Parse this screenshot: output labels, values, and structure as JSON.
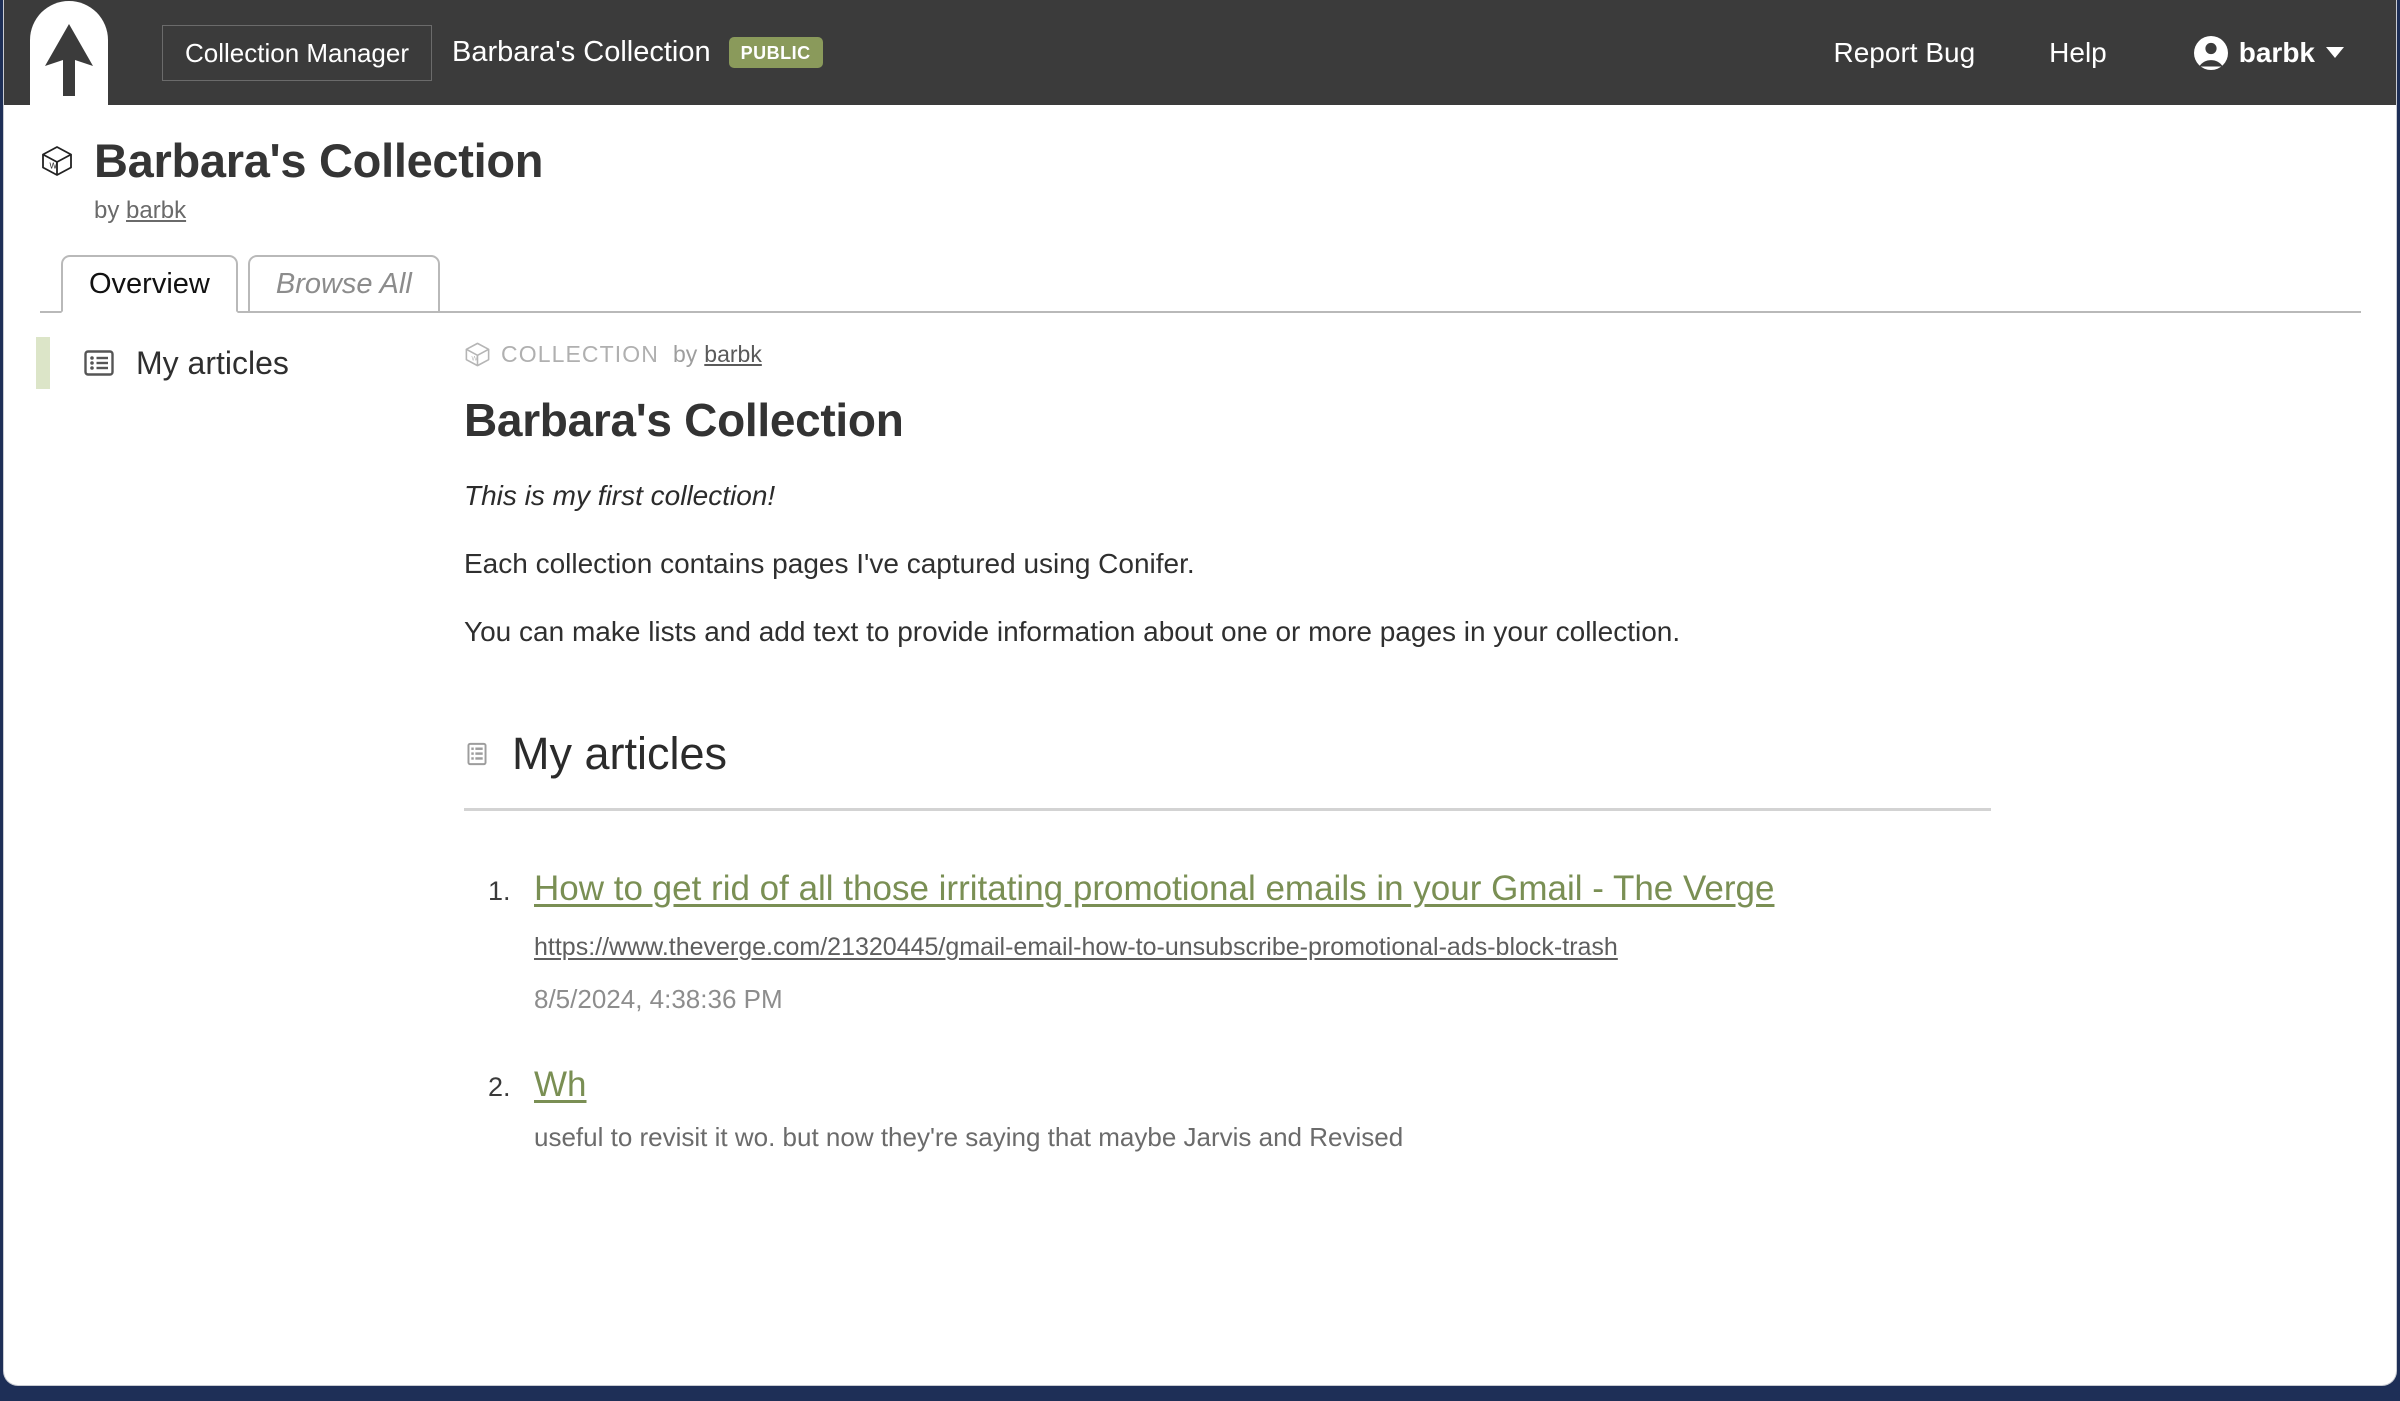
{
  "navbar": {
    "logo_icon": "conifer-arrow-logo",
    "collection_manager_label": "Collection Manager",
    "collection_title": "Barbara's Collection",
    "visibility_badge": "PUBLIC",
    "report_bug_label": "Report Bug",
    "help_label": "Help",
    "user_name": "barbk",
    "user_icon": "account-circle-icon",
    "caret_icon": "chevron-down-icon",
    "background_color": "#3b3b3b"
  },
  "page_header": {
    "icon": "collection-box-icon",
    "title": "Barbara's Collection",
    "by_prefix": "by",
    "author": "barbk"
  },
  "tabs": [
    {
      "label": "Overview",
      "active": true
    },
    {
      "label": "Browse All",
      "active": false
    }
  ],
  "sidebar": {
    "items": [
      {
        "label": "My articles",
        "icon": "list-icon",
        "active": true
      }
    ],
    "active_marker_color": "#dce5c8"
  },
  "main": {
    "kicker": {
      "icon": "collection-box-icon",
      "type_label": "COLLECTION",
      "by_prefix": "by",
      "author": "barbk"
    },
    "title": "Barbara's Collection",
    "paragraphs": [
      {
        "text": "This is my first collection!",
        "italic": true
      },
      {
        "text": "Each collection contains pages I've captured using Conifer.",
        "italic": false
      },
      {
        "text": "You can make lists and add text to provide information about one or more pages in your collection.",
        "italic": false
      }
    ],
    "section": {
      "icon": "list-icon",
      "heading": "My articles"
    },
    "articles": [
      {
        "title": "How to get rid of all those irritating promotional emails in your Gmail - The Verge",
        "url": "https://www.theverge.com/21320445/gmail-email-how-to-unsubscribe-promotional-ads-block-trash",
        "date": "8/5/2024, 4:38:36 PM"
      },
      {
        "title": "Wh",
        "url": "",
        "date": "",
        "snippet": "useful to revisit it wo. but now they're saying that  maybe  Jarvis and Revised"
      }
    ]
  },
  "colors": {
    "link_green": "#7a8f54",
    "badge_green": "#8a9a5b",
    "navbar": "#3b3b3b",
    "window_border": "#1e2f57"
  }
}
